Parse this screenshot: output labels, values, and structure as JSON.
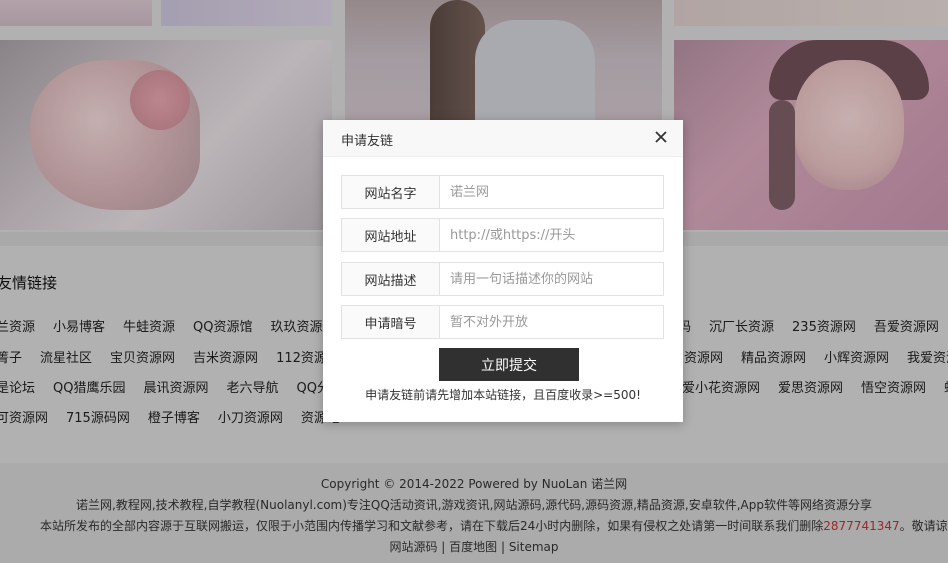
{
  "friend_links": {
    "title": "友情链接",
    "row1_left": [
      "兰资源",
      "小易博客",
      "牛蛙资源",
      "QQ资源馆",
      "玖玖资源网"
    ],
    "row1_right": [
      "码",
      "沉厂长资源",
      "235资源网",
      "吾爱资源网"
    ],
    "row2_left": [
      "箐子",
      "流星社区",
      "宝贝资源网",
      "吉米资源网",
      "112资源网"
    ],
    "row2_right": [
      "资源网",
      "精品资源网",
      "小辉资源网",
      "我爱资源"
    ],
    "row3_left": [
      "是论坛",
      "QQ猎鹰乐园",
      "晨讯资源网",
      "老六导航",
      "QQ分享"
    ],
    "row3_right": [
      "爱小花资源网",
      "爱思资源网",
      "悟空资源网",
      "蚂"
    ],
    "row4_left": [
      "可资源网",
      "715源码网",
      "橙子博客",
      "小刀资源网",
      "资源吧"
    ]
  },
  "footer": {
    "copyright": "Copyright © 2014-2022  Powered by NuoLan 诺兰网",
    "description": "诺兰网,教程网,技术教程,自学教程(Nuolanyl.com)专注QQ活动资讯,游戏资讯,网站源码,源代码,源码资源,精品资源,安卓软件,App软件等网络资源分享",
    "disclaimer_prefix": "本站所发布的全部内容源于互联网搬运，仅限于小范围内传播学习和文献参考，请在下载后24小时内删除，如果有侵权之处请第一时间联系我们删除",
    "contact_qq": "2877741347",
    "disclaimer_suffix": "。敬请谅解",
    "nav_links": "网站源码 | 百度地图 | Sitemap"
  },
  "modal": {
    "title": "申请友链",
    "fields": [
      {
        "label": "网站名字",
        "placeholder": "诺兰网"
      },
      {
        "label": "网站地址",
        "placeholder": "http://或https://开头"
      },
      {
        "label": "网站描述",
        "placeholder": "请用一句话描述你的网站"
      },
      {
        "label": "申请暗号",
        "placeholder": "暂不对外开放"
      }
    ],
    "submit_label": "立即提交",
    "notice": "申请友链前请先增加本站链接，且百度收录>=500!"
  },
  "colors": {
    "submit_bg": "#303030",
    "contact_red": "#b33333"
  }
}
